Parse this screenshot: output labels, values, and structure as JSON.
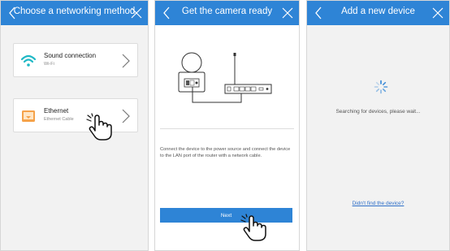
{
  "colors": {
    "accent": "#2e84d6",
    "page_bg": "#f2f2f2",
    "wifi_icon": "#1fb8c5",
    "ethernet_icon": "#f5a24a",
    "link": "#2e6fc8"
  },
  "screen1": {
    "title": "Choose a networking method",
    "back_icon": "chevron-left-icon",
    "close_icon": "close-icon",
    "options": [
      {
        "label": "Sound connection",
        "sublabel": "Wi-Fi",
        "icon": "wifi-icon"
      },
      {
        "label": "Ethernet",
        "sublabel": "Ethernet Cable",
        "icon": "ethernet-icon"
      }
    ]
  },
  "screen2": {
    "title": "Get the camera ready",
    "instructions": "Connect the device to the power source and connect the device to the LAN port of the router with a network cable.",
    "next_label": "Next"
  },
  "screen3": {
    "title": "Add a new device",
    "status": "Searching for devices, please wait...",
    "help_link": "Didn't find the device?"
  }
}
